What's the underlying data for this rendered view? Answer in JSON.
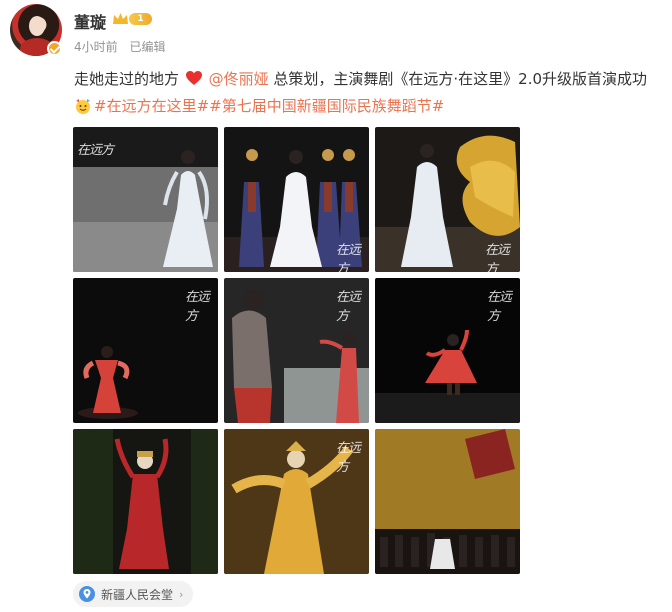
{
  "post": {
    "author": "董璇",
    "vip_level": "1",
    "time": "4小时前",
    "edited": "已编辑",
    "text_part1": "走她走过的地方",
    "mention": "@佟丽娅",
    "text_part2": " 总策划，主演舞剧《在远方·在这里》2.0升级版首演成功",
    "topic1": "#在远方在这里#",
    "topic2": "#第七届中国新疆国际民族舞蹈节#",
    "location": "新疆人民会堂"
  },
  "images": [
    {
      "alt": "dancer in white dress",
      "watermark": "在远方"
    },
    {
      "alt": "white dress dancer with ensemble",
      "watermark": "在远方"
    },
    {
      "alt": "white dress dancer with gold fabric",
      "watermark": "在远方"
    },
    {
      "alt": "red dress dancer",
      "watermark": "在远方"
    },
    {
      "alt": "two dancers",
      "watermark": "在远方"
    },
    {
      "alt": "spinning red dancer",
      "watermark": "在远方"
    },
    {
      "alt": "dancer arms raised",
      "watermark": ""
    },
    {
      "alt": "golden costume dancer",
      "watermark": "在远方"
    },
    {
      "alt": "ensemble on stage",
      "watermark": ""
    }
  ],
  "colors": {
    "link": "#eb7350",
    "meta": "#939393",
    "verified": "#f5a623"
  }
}
